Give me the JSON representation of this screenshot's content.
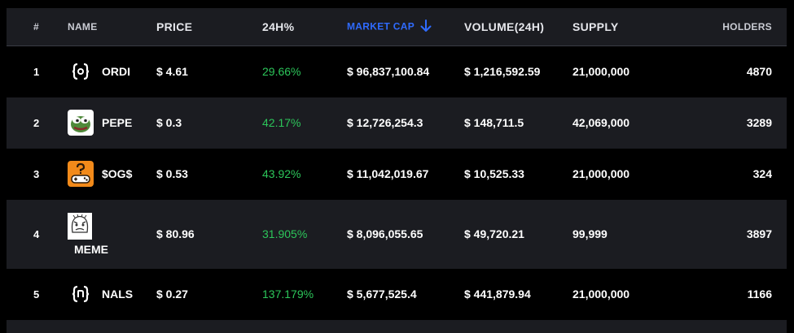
{
  "headers": {
    "rank": "#",
    "name": "NAME",
    "price": "PRICE",
    "change": "24H%",
    "market_cap": "MARKET CAP",
    "volume": "VOLUME(24H)",
    "supply": "SUPPLY",
    "holders": "HOLDERS"
  },
  "colors": {
    "accent": "#2f6bff",
    "positive": "#2cc65a"
  },
  "rows": [
    {
      "rank": "1",
      "name": "ORDI",
      "logo": "bracket-o-icon",
      "price": "$ 4.61",
      "change": "29.66%",
      "market_cap": "$ 96,837,100.84",
      "volume": "$ 1,216,592.59",
      "supply": "21,000,000",
      "holders": "4870"
    },
    {
      "rank": "2",
      "name": "PEPE",
      "logo": "pepe-frog-icon",
      "price": "$ 0.3",
      "change": "42.17%",
      "market_cap": "$ 12,726,254.3",
      "volume": "$ 148,711.5",
      "supply": "42,069,000",
      "holders": "3289"
    },
    {
      "rank": "3",
      "name": "$OG$",
      "logo": "gamepad-question-icon",
      "price": "$ 0.53",
      "change": "43.92%",
      "market_cap": "$ 11,042,019.67",
      "volume": "$ 10,525.33",
      "supply": "21,000,000",
      "holders": "324"
    },
    {
      "rank": "4",
      "name": "MEME",
      "logo": "meme-face-icon",
      "price": "$ 80.96",
      "change": "31.905%",
      "market_cap": "$ 8,096,055.65",
      "volume": "$ 49,720.21",
      "supply": "99,999",
      "holders": "3897"
    },
    {
      "rank": "5",
      "name": "NALS",
      "logo": "bracket-n-icon",
      "price": "$ 0.27",
      "change": "137.179%",
      "market_cap": "$ 5,677,525.4",
      "volume": "$ 441,879.94",
      "supply": "21,000,000",
      "holders": "1166"
    }
  ]
}
